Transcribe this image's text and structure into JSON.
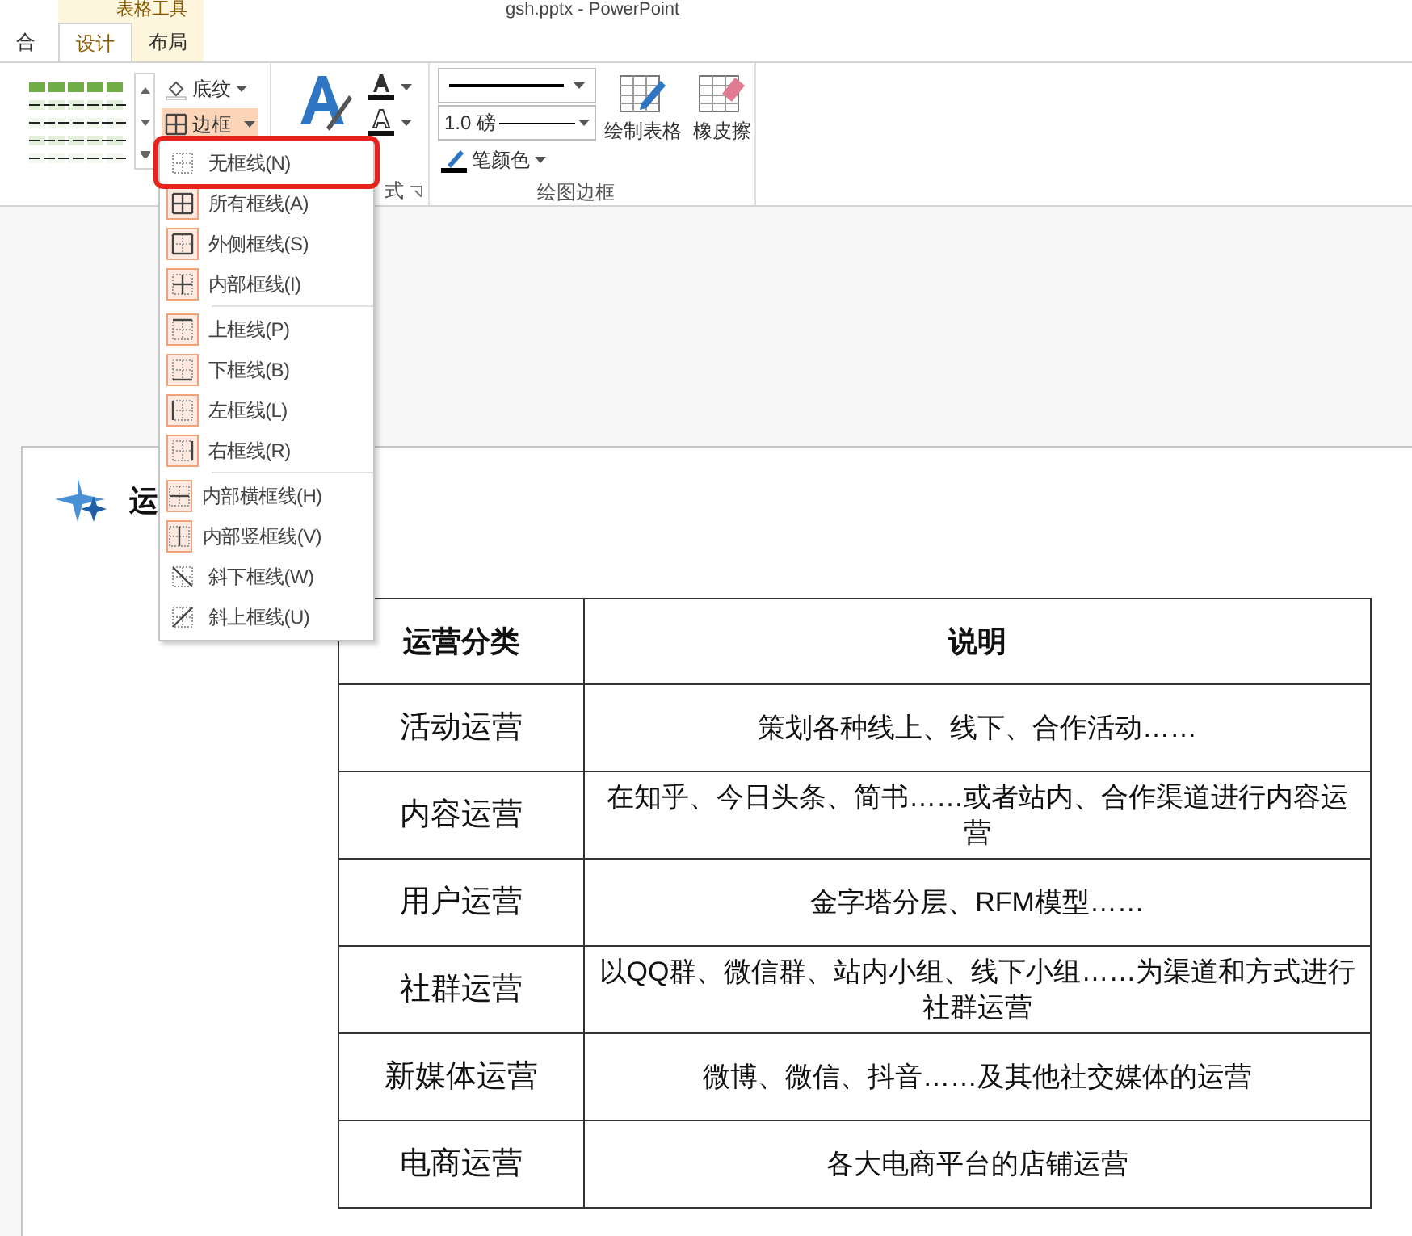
{
  "title_bar": {
    "context_group": "表格工具",
    "document_title": "gsh.pptx - PowerPoint"
  },
  "tabs": [
    {
      "label": "合",
      "selected": false,
      "contextual": false
    },
    {
      "label": "设计",
      "selected": true,
      "contextual": true
    },
    {
      "label": "布局",
      "selected": false,
      "contextual": true
    }
  ],
  "ribbon": {
    "shading_button": "底纹",
    "borders_button": {
      "label": "边框",
      "pressed": true
    },
    "wordart_group_label": "式",
    "pen_weight": "1.0 磅",
    "pen_color": "笔颜色",
    "draw_table": "绘制表格",
    "eraser": "橡皮擦",
    "draw_borders_group_label": "绘图边框"
  },
  "border_menu": {
    "groups": [
      [
        {
          "label": "无框线(N)",
          "kind": "none",
          "framed": false,
          "highlighted": true
        },
        {
          "label": "所有框线(A)",
          "kind": "all",
          "framed": true,
          "highlighted": false
        },
        {
          "label": "外侧框线(S)",
          "kind": "outside",
          "framed": true,
          "highlighted": false
        },
        {
          "label": "内部框线(I)",
          "kind": "inside",
          "framed": true,
          "highlighted": false
        }
      ],
      [
        {
          "label": "上框线(P)",
          "kind": "top",
          "framed": true,
          "highlighted": false
        },
        {
          "label": "下框线(B)",
          "kind": "bottom",
          "framed": true,
          "highlighted": false
        },
        {
          "label": "左框线(L)",
          "kind": "left",
          "framed": true,
          "highlighted": false
        },
        {
          "label": "右框线(R)",
          "kind": "right",
          "framed": true,
          "highlighted": false
        }
      ],
      [
        {
          "label": "内部横框线(H)",
          "kind": "inside_h",
          "framed": true,
          "highlighted": false
        },
        {
          "label": "内部竖框线(V)",
          "kind": "inside_v",
          "framed": true,
          "highlighted": false
        },
        {
          "label": "斜下框线(W)",
          "kind": "diag_down",
          "framed": false,
          "highlighted": false
        },
        {
          "label": "斜上框线(U)",
          "kind": "diag_up",
          "framed": false,
          "highlighted": false
        }
      ]
    ]
  },
  "slide": {
    "title": "运",
    "table": {
      "columns": [
        "运营分类",
        "说明"
      ],
      "rows": [
        [
          "活动运营",
          "策划各种线上、线下、合作活动……"
        ],
        [
          "内容运营",
          "在知乎、今日头条、简书……或者站内、合作渠道进行内容运营"
        ],
        [
          "用户运营",
          "金字塔分层、RFM模型……"
        ],
        [
          "社群运营",
          "以QQ群、微信群、站内小组、线下小组……为渠道和方式进行社群运营"
        ],
        [
          "新媒体运营",
          "微博、微信、抖音……及其他社交媒体的运营"
        ],
        [
          "电商运营",
          "各大电商平台的店铺运营"
        ]
      ]
    }
  }
}
